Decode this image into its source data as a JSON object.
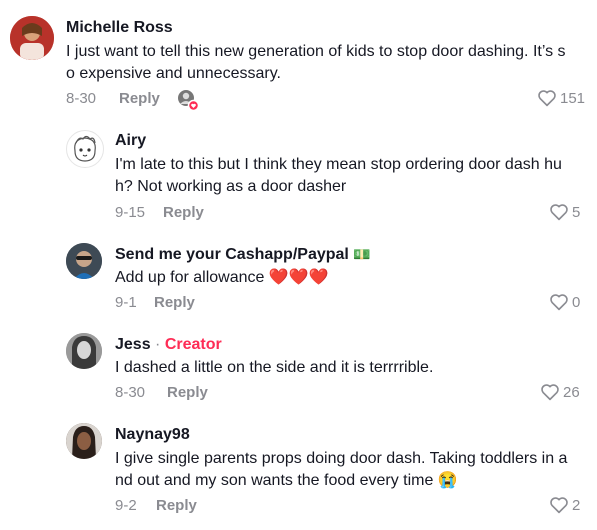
{
  "comments": [
    {
      "username": "Michelle Ross",
      "text_lines": [
        "I just want to tell this new generation of kids to stop door dashing. It’s s",
        "o expensive and unnecessary."
      ],
      "date": "8-30",
      "reply_label": "Reply",
      "likes": "151"
    },
    {
      "username": "Airy",
      "text_lines": [
        "I'm late to this but I think they mean stop ordering door dash hu",
        "h? Not working as a door dasher"
      ],
      "date": "9-15",
      "reply_label": "Reply",
      "likes": "5"
    },
    {
      "username": "Send me your Cashapp/Paypal",
      "username_emoji": "💵",
      "text": "Add up for allowance",
      "text_emoji": "❤️❤️❤️",
      "date": "9-1",
      "reply_label": "Reply",
      "likes": "0"
    },
    {
      "username": "Jess",
      "separator": " · ",
      "badge": "Creator",
      "text": "I dashed a little on the side and it is terrrrible.",
      "date": "8-30",
      "reply_label": "Reply",
      "likes": "26"
    },
    {
      "username": "Naynay98",
      "text_lines": [
        "I give single parents props doing door dash. Taking toddlers in a",
        "nd out and my son wants the food every time"
      ],
      "text_emoji": "😭",
      "date": "9-2",
      "reply_label": "Reply",
      "likes": "2"
    }
  ],
  "colors": {
    "text": "#161823",
    "muted": "#8a8b91",
    "creator": "#fe2c55",
    "heart": "#e8323c"
  },
  "icons": {
    "like": "heart-outline-icon",
    "author_liked": "creator-avatar-liked-icon"
  }
}
